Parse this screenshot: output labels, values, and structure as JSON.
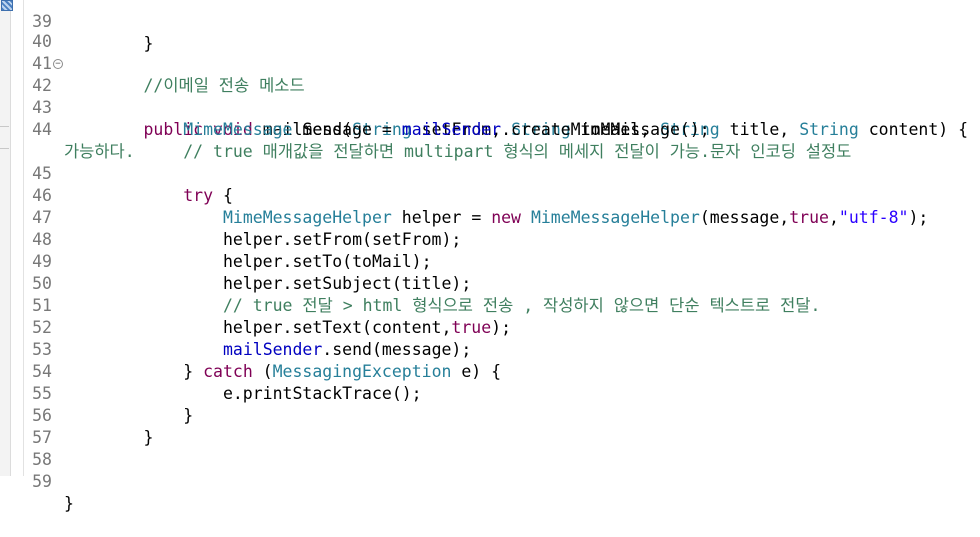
{
  "editor": {
    "language": "java",
    "colors": {
      "keyword": "#7f0055",
      "type": "#267f99",
      "field": "#0000c0",
      "string": "#2a00ff",
      "comment": "#3f7f5f",
      "param": "#6a3e3e"
    },
    "fold_icon": "minus-circle-icon",
    "top_partial": {
      "number": "39",
      "text": "        }"
    },
    "lines": [
      {
        "number": "40",
        "text": ""
      },
      {
        "number": "41",
        "text": "        //이메일 전송 메소드"
      },
      {
        "number": "42",
        "text": "        public void mailSend(String setFrom, String toMail, String title, String content) {"
      },
      {
        "number": "43",
        "text": "            MimeMessage message = mailSender.createMimeMessage();"
      },
      {
        "number": "44",
        "text": "            // true 매개값을 전달하면 multipart 형식의 메세지 전달이 가능.문자 인코딩 설정도",
        "wrap": "가능하다."
      },
      {
        "number": "45",
        "text": "            try {"
      },
      {
        "number": "46",
        "text": "                MimeMessageHelper helper = new MimeMessageHelper(message,true,\"utf-8\");"
      },
      {
        "number": "47",
        "text": "                helper.setFrom(setFrom);"
      },
      {
        "number": "48",
        "text": "                helper.setTo(toMail);"
      },
      {
        "number": "49",
        "text": "                helper.setSubject(title);"
      },
      {
        "number": "50",
        "text": "                // true 전달 > html 형식으로 전송 , 작성하지 않으면 단순 텍스트로 전달."
      },
      {
        "number": "51",
        "text": "                helper.setText(content,true);"
      },
      {
        "number": "52",
        "text": "                mailSender.send(message);"
      },
      {
        "number": "53",
        "text": "            } catch (MessagingException e) {"
      },
      {
        "number": "54",
        "text": "                e.printStackTrace();"
      },
      {
        "number": "55",
        "text": "            }"
      },
      {
        "number": "56",
        "text": "        }"
      },
      {
        "number": "57",
        "text": ""
      },
      {
        "number": "58",
        "text": ""
      },
      {
        "number": "59",
        "text": "}"
      }
    ]
  }
}
